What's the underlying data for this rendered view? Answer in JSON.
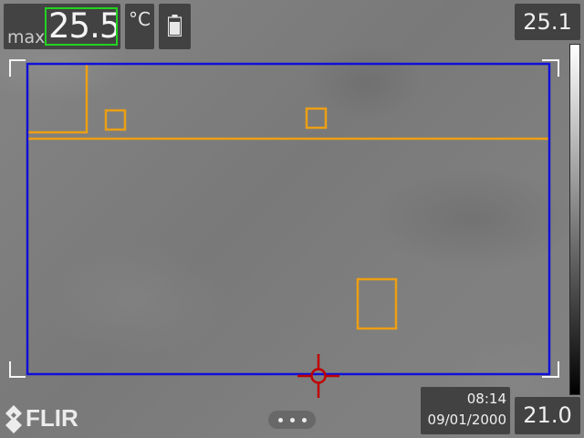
{
  "header": {
    "max_label": "max",
    "max_value": "25.5",
    "unit": "°C",
    "battery_icon": "battery-icon"
  },
  "scale": {
    "max": "25.1",
    "min": "21.0"
  },
  "footer": {
    "time": "08:14",
    "date": "09/01/2000",
    "logo_text": "FLIR",
    "menu_icon": "more-dots-icon"
  },
  "colors": {
    "measurement_box": "#1010d8",
    "overlay_orange": "#ec9f13",
    "spot_meter": "#c00000",
    "max_highlight": "#22d320"
  }
}
